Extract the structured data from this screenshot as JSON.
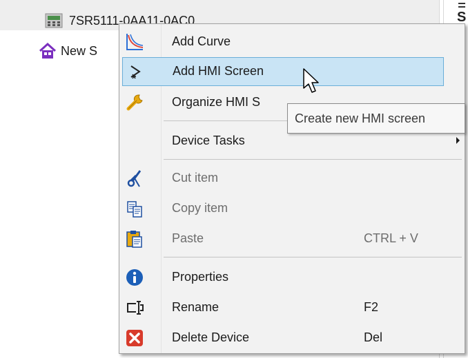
{
  "tree": {
    "device_label": "7SR5111-0AA11-0AC0",
    "new_item_label": "New S"
  },
  "right_pane": {
    "visible_text": "S"
  },
  "context_menu": {
    "items": [
      {
        "label": "Add Curve",
        "icon": "curve-chart-icon",
        "shortcut": ""
      },
      {
        "label": "Add HMI Screen",
        "icon": "hmi-screen-icon",
        "shortcut": ""
      },
      {
        "label": "Organize HMI S",
        "icon": "wrench-icon",
        "shortcut": ""
      },
      {
        "label": "Device Tasks",
        "icon": "",
        "shortcut": ""
      },
      {
        "label": "Cut item",
        "icon": "scissors-icon",
        "shortcut": ""
      },
      {
        "label": "Copy item",
        "icon": "copy-icon",
        "shortcut": ""
      },
      {
        "label": "Paste",
        "icon": "paste-icon",
        "shortcut": "CTRL + V"
      },
      {
        "label": "Properties",
        "icon": "info-icon",
        "shortcut": ""
      },
      {
        "label": "Rename",
        "icon": "rename-icon",
        "shortcut": "F2"
      },
      {
        "label": "Delete Device",
        "icon": "delete-icon",
        "shortcut": "Del"
      }
    ]
  },
  "tooltip": {
    "text": "Create new HMI screen"
  },
  "colors": {
    "hover_bg": "#c9e4f5",
    "hover_border": "#6aaed8",
    "menu_bg": "#f2f2f2",
    "info_blue": "#1c5fb8",
    "delete_red": "#d83b2b"
  }
}
